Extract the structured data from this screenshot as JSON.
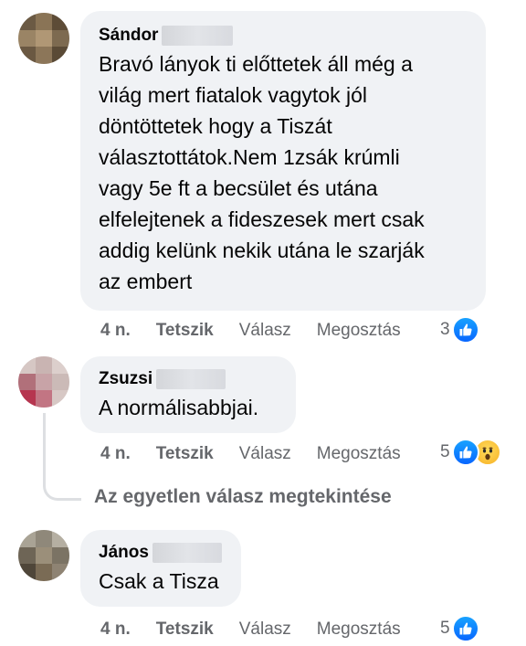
{
  "comments": [
    {
      "author": "Sándor",
      "text": "Bravó lányok ti előttetek áll még a\nvilág mert fiatalok vagytok jól\ndöntöttetek hogy a Tiszát\nválasztottátok.Nem 1zsák krúmli\nvagy 5e ft a becsület és utána\nelfelejtenek a fideszesek mert csak\naddig kelünk nekik utána le szarják\naz embert",
      "age": "4 n.",
      "like_label": "Tetszik",
      "reply_label": "Válasz",
      "share_label": "Megosztás",
      "reaction_count": "3",
      "reactions": [
        "like-icon"
      ]
    },
    {
      "author": "Zsuzsi",
      "text": "A normálisabbjai.",
      "age": "4 n.",
      "like_label": "Tetszik",
      "reply_label": "Válasz",
      "share_label": "Megosztás",
      "reaction_count": "5",
      "reactions": [
        "like-icon",
        "wow-icon"
      ]
    },
    {
      "author": "János",
      "text": "Csak a Tisza",
      "age": "4 n.",
      "like_label": "Tetszik",
      "reply_label": "Válasz",
      "share_label": "Megosztás",
      "reaction_count": "5",
      "reactions": [
        "like-icon"
      ]
    }
  ],
  "view_replies_label": "Az egyetlen válasz megtekintése",
  "colors": {
    "bubble": "#f0f2f5",
    "secondary_text": "#65676b",
    "like_blue": "#0866ff"
  }
}
